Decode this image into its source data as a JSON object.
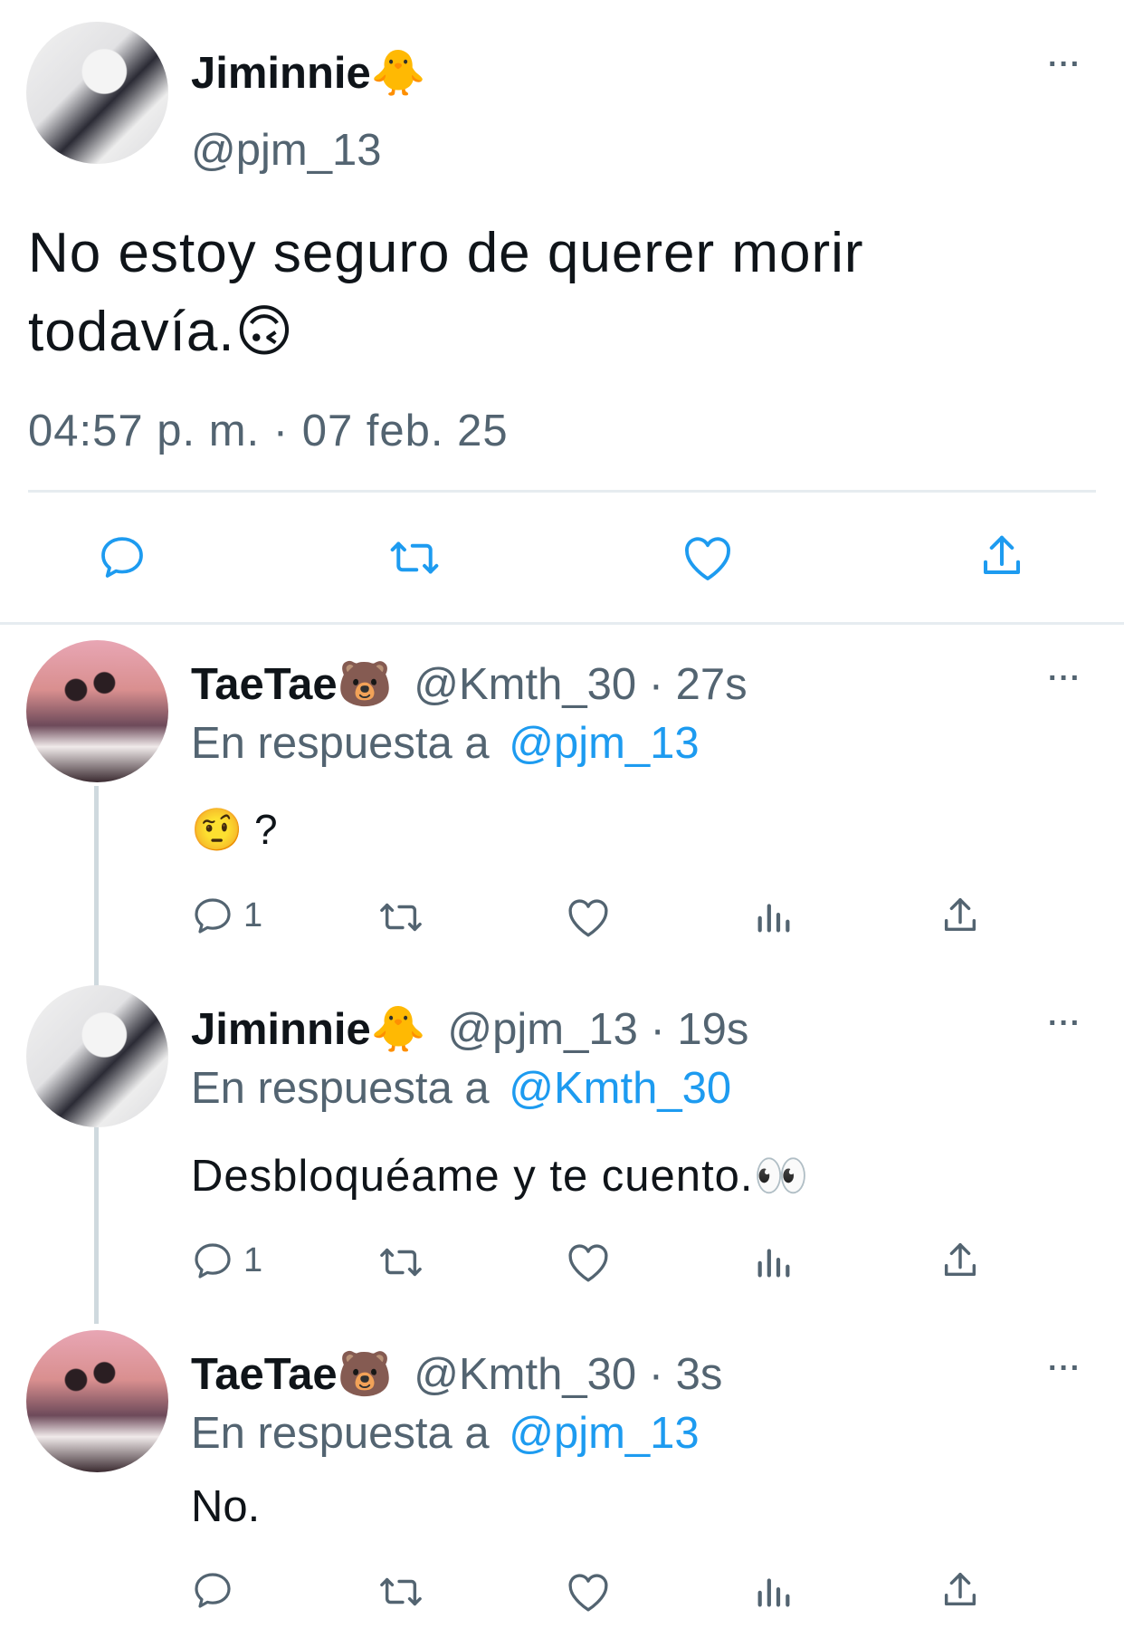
{
  "main_tweet": {
    "display_name": "Jiminnie🐥",
    "handle": "@pjm_13",
    "text": "No estoy seguro de querer morir todavía.🙃",
    "timestamp": "04:57 p. m. · 07 feb. 25",
    "more_label": "···"
  },
  "replies": [
    {
      "display_name": "TaeTae🐻",
      "handle": "@Kmth_30",
      "time": "27s",
      "reply_prefix": "En respuesta a",
      "reply_to": "@pjm_13",
      "text": "🤨 ?",
      "reply_count": "1",
      "more_label": "···"
    },
    {
      "display_name": "Jiminnie🐥",
      "handle": "@pjm_13",
      "time": "19s",
      "reply_prefix": "En respuesta a",
      "reply_to": "@Kmth_30",
      "text": "Desbloquéame y te cuento.👀",
      "reply_count": "1",
      "more_label": "···"
    },
    {
      "display_name": "TaeTae🐻",
      "handle": "@Kmth_30",
      "time": "3s",
      "reply_prefix": "En respuesta a",
      "reply_to": "@pjm_13",
      "text": "No.",
      "reply_count": "",
      "more_label": "···"
    }
  ],
  "separator": " · ",
  "icons": [
    "comment-icon",
    "retweet-icon",
    "like-icon",
    "views-icon",
    "share-icon",
    "more-icon"
  ],
  "colors": {
    "link": "#1d9bf0",
    "secondary": "#536471",
    "text": "#0f1419"
  }
}
